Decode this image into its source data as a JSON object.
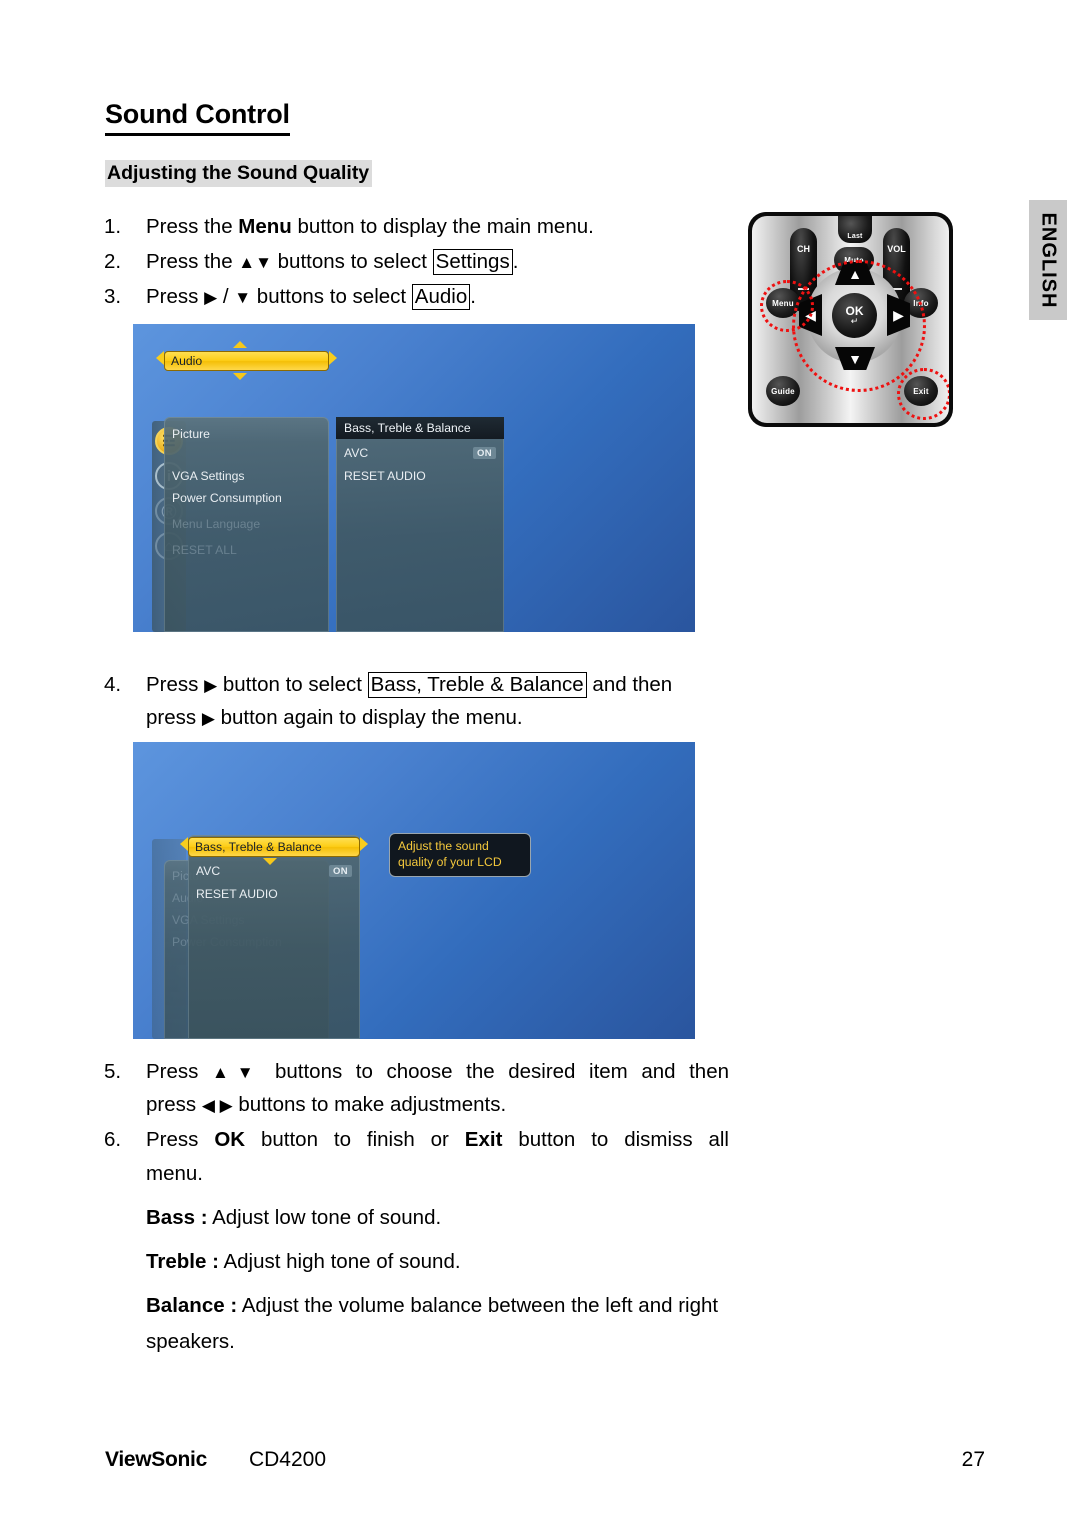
{
  "page": {
    "heading": "Sound Control",
    "subheading": "Adjusting the Sound Quality",
    "language_tab": "ENGLISH"
  },
  "steps": {
    "group_a": [
      {
        "num": "1.",
        "parts": [
          {
            "t": "Press the ",
            "style": "normal"
          },
          {
            "t": "Menu",
            "style": "bold"
          },
          {
            "t": " button to display the main menu.",
            "style": "normal"
          }
        ]
      },
      {
        "num": "2.",
        "parts": [
          {
            "t": "Press the ",
            "style": "normal"
          },
          {
            "t": "▲▼",
            "style": "glyph"
          },
          {
            "t": " buttons to select ",
            "style": "normal"
          },
          {
            "t": "Settings",
            "style": "boxed"
          },
          {
            "t": ".",
            "style": "normal"
          }
        ]
      },
      {
        "num": "3.",
        "parts": [
          {
            "t": "Press ",
            "style": "normal"
          },
          {
            "t": "▶",
            "style": "glyph"
          },
          {
            "t": " / ",
            "style": "normal"
          },
          {
            "t": "▼",
            "style": "glyph"
          },
          {
            "t": " buttons to select ",
            "style": "normal"
          },
          {
            "t": "Audio",
            "style": "boxed"
          },
          {
            "t": ".",
            "style": "normal"
          }
        ]
      }
    ],
    "group_b": [
      {
        "num": "4.",
        "line1": [
          {
            "t": "Press ",
            "style": "normal"
          },
          {
            "t": "▶",
            "style": "glyph"
          },
          {
            "t": " button to select ",
            "style": "normal"
          },
          {
            "t": "Bass, Treble & Balance",
            "style": "boxed"
          },
          {
            "t": " and then",
            "style": "normal"
          }
        ],
        "line2": [
          {
            "t": "press ",
            "style": "normal"
          },
          {
            "t": "▶",
            "style": "glyph"
          },
          {
            "t": " button again to display the menu.",
            "style": "normal"
          }
        ]
      }
    ],
    "group_c": [
      {
        "num": "5.",
        "line1": [
          {
            "t": "Press ",
            "style": "normal"
          },
          {
            "t": "▲▼",
            "style": "glyph"
          },
          {
            "t": " buttons to choose the desired item and then",
            "style": "normal"
          }
        ],
        "line2": [
          {
            "t": "press ",
            "style": "normal"
          },
          {
            "t": "◀ ▶",
            "style": "glyph"
          },
          {
            "t": " buttons to make adjustments.",
            "style": "normal"
          }
        ]
      },
      {
        "num": "6.",
        "line1": [
          {
            "t": "Press ",
            "style": "normal"
          },
          {
            "t": "OK",
            "style": "bold"
          },
          {
            "t": " button to finish or ",
            "style": "normal"
          },
          {
            "t": "Exit",
            "style": "bold"
          },
          {
            "t": " button to dismiss all",
            "style": "normal"
          }
        ],
        "line2": [
          {
            "t": "menu.",
            "style": "normal"
          }
        ]
      }
    ]
  },
  "definitions": [
    {
      "term": "Bass :",
      "desc": " Adjust low tone of sound."
    },
    {
      "term": "Treble :",
      "desc": " Adjust high tone of sound."
    },
    {
      "term": "Balance :",
      "desc": " Adjust the volume balance between the left and right speakers."
    }
  ],
  "osd_1": {
    "rail_icons": [
      {
        "name": "audio-icon",
        "glyph": "☲",
        "state": "active"
      },
      {
        "name": "info-icon",
        "glyph": "i",
        "state": "normal"
      },
      {
        "name": "menu-language-icon",
        "glyph": "Ⓡ",
        "state": "dim"
      },
      {
        "name": "reset-all-icon",
        "glyph": "⌂",
        "state": "dim"
      }
    ],
    "left_menu": [
      {
        "label": "Picture",
        "state": "normal"
      },
      {
        "label": "Audio",
        "state": "selected"
      },
      {
        "label": "VGA Settings",
        "state": "normal"
      },
      {
        "label": "Power Consumption",
        "state": "normal"
      },
      {
        "label": "Menu Language",
        "state": "faded"
      },
      {
        "label": "RESET ALL",
        "state": "faded"
      }
    ],
    "right_menu": {
      "title": "Bass, Treble & Balance",
      "items": [
        {
          "label": "AVC",
          "value": "ON"
        },
        {
          "label": "RESET AUDIO",
          "value": ""
        }
      ]
    }
  },
  "osd_2": {
    "background_menu": [
      {
        "label": "Picture",
        "state": "faded"
      },
      {
        "label": "Audio",
        "state": "faded"
      },
      {
        "label": "VGA Settings",
        "state": "faded"
      },
      {
        "label": "Power Consumption",
        "state": "faded"
      }
    ],
    "front_menu": [
      {
        "label": "Bass, Treble & Balance",
        "state": "selected",
        "value": ""
      },
      {
        "label": "AVC",
        "state": "normal",
        "value": "ON"
      },
      {
        "label": "RESET AUDIO",
        "state": "normal",
        "value": ""
      }
    ],
    "tooltip": "Adjust the sound quality of your LCD"
  },
  "remote": {
    "buttons": [
      {
        "name": "last-button",
        "label": "Last"
      },
      {
        "name": "ch-rocker",
        "label": "CH"
      },
      {
        "name": "vol-rocker",
        "label": "VOL"
      },
      {
        "name": "mute-button",
        "label": "Mute"
      },
      {
        "name": "menu-button",
        "label": "Menu"
      },
      {
        "name": "info-button",
        "label": "Info"
      },
      {
        "name": "guide-button",
        "label": "Guide"
      },
      {
        "name": "exit-button",
        "label": "Exit"
      },
      {
        "name": "ok-button",
        "label": "OK"
      }
    ],
    "ok_label": "OK",
    "last_label": "Last",
    "ch_label": "CH",
    "vol_label": "VOL",
    "mute_label": "Mute",
    "menu_label": "Menu",
    "info_label": "Info",
    "guide_label": "Guide",
    "exit_label": "Exit"
  },
  "footer": {
    "brand": "ViewSonic",
    "model": "CD4200",
    "page_number": "27"
  },
  "colors": {
    "highlight_yellow": "#fdcd16",
    "osd_blue_light": "#5d95de",
    "osd_blue_dark": "#2a559e",
    "panel_gray": "#40585f",
    "annotation_red": "#ee1111",
    "subheading_bg": "#dcdcdc",
    "lang_tab_bg": "#c9c9c9"
  }
}
